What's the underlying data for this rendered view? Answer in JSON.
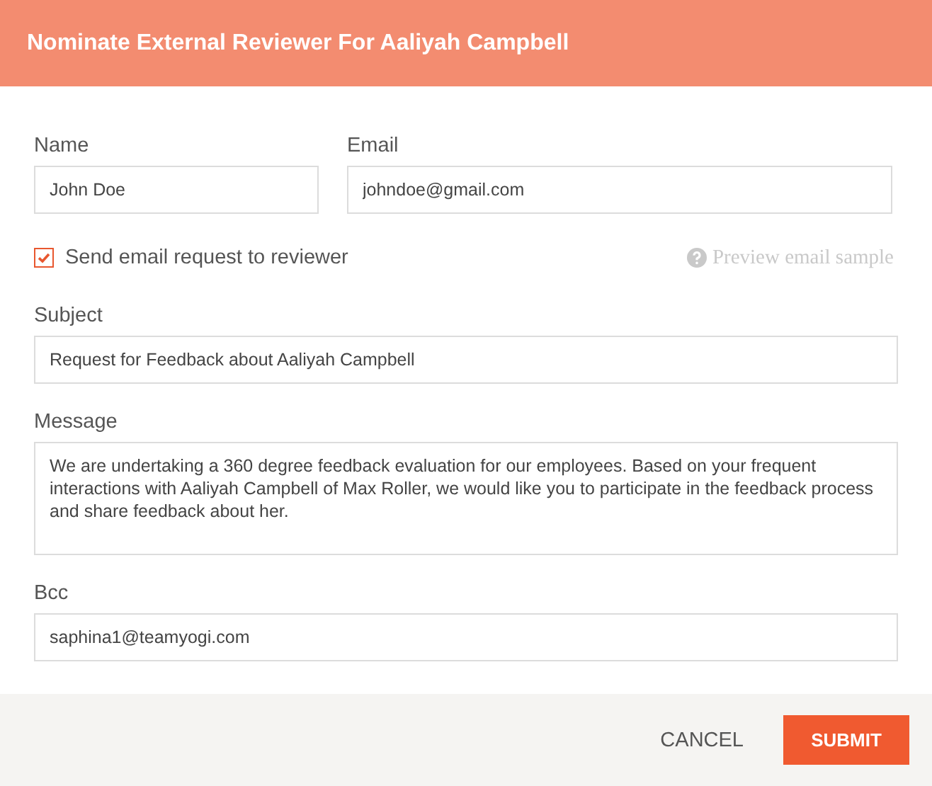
{
  "dialog": {
    "title": "Nominate External Reviewer For Aaliyah Campbell"
  },
  "name_field": {
    "label": "Name",
    "value": "John Doe"
  },
  "email_field": {
    "label": "Email",
    "value": "johndoe@gmail.com"
  },
  "send_email": {
    "label": "Send email request to reviewer",
    "checked": true
  },
  "preview_link": {
    "label": "Preview email sample"
  },
  "subject_field": {
    "label": "Subject",
    "value": "Request for Feedback about Aaliyah Campbell"
  },
  "message_field": {
    "label": "Message",
    "value": "We are undertaking a 360 degree feedback evaluation for our employees. Based on your frequent interactions with Aaliyah Campbell of Max Roller, we would like you to participate in the feedback process and share feedback about her."
  },
  "bcc_field": {
    "label": "Bcc",
    "value": "saphina1@teamyogi.com"
  },
  "buttons": [
    {
      "kind": "secondary",
      "label": "CANCEL"
    },
    {
      "kind": "primary",
      "label": "SUBMIT"
    }
  ]
}
